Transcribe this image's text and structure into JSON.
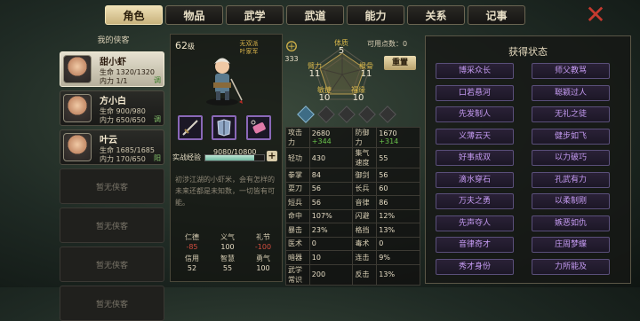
{
  "tabs": [
    "角色",
    "物品",
    "武学",
    "武道",
    "能力",
    "关系",
    "记事"
  ],
  "active_tab": 0,
  "left": {
    "title": "我的侠客",
    "heroes": [
      {
        "name": "甜小虾",
        "hp_label": "生命",
        "hp": "1320/1320",
        "mp_label": "内力",
        "mp": "1/1",
        "tag": "调",
        "selected": true
      },
      {
        "name": "方小白",
        "hp_label": "生命",
        "hp": "900/980",
        "mp_label": "内力",
        "mp": "650/650",
        "tag": "调",
        "selected": false
      },
      {
        "name": "叶云",
        "hp_label": "生命",
        "hp": "1685/1685",
        "mp_label": "内力",
        "mp": "170/650",
        "tag": "阳",
        "selected": false
      }
    ],
    "empty_label": "暂无侠客",
    "empty_count": 4
  },
  "char": {
    "level_num": "62",
    "level_unit": "级",
    "sect_line1": "无双派",
    "sect_line2": "叶家军",
    "exp_label": "实战经验",
    "exp_value": "9080/10800",
    "exp_ratio": 0.84,
    "plus": "+",
    "desc": "初涉江湖的小虾米，会有怎样的未来还都是未知数，一切皆有可能。",
    "virtues": [
      {
        "k": "仁德",
        "v": "-85",
        "neg": true
      },
      {
        "k": "义气",
        "v": "100"
      },
      {
        "k": "礼节",
        "v": "-100",
        "neg": true
      },
      {
        "k": "信用",
        "v": "52"
      },
      {
        "k": "智慧",
        "v": "55"
      },
      {
        "k": "勇气",
        "v": "100"
      }
    ]
  },
  "attrs": {
    "mark_value": "333",
    "free_points_label": "可用点数：",
    "free_points": "0",
    "reset_label": "重置",
    "tizhi": {
      "k": "体质",
      "v": "5"
    },
    "biili": {
      "k": "臂力",
      "v": "11"
    },
    "gengu": {
      "k": "根骨",
      "v": "11"
    },
    "minjie": {
      "k": "敏捷",
      "v": "10"
    },
    "fuyuan": {
      "k": "福缘",
      "v": "10"
    }
  },
  "stats": [
    [
      {
        "k": "攻击力",
        "v": "2680",
        "bonus": "+344"
      },
      {
        "k": "防御力",
        "v": "1670",
        "bonus": "+314"
      }
    ],
    [
      {
        "k": "轻功",
        "v": "430"
      },
      {
        "k": "集气速度",
        "v": "55"
      }
    ],
    [
      {
        "k": "拳掌",
        "v": "84"
      },
      {
        "k": "御剑",
        "v": "56"
      }
    ],
    [
      {
        "k": "耍刀",
        "v": "56"
      },
      {
        "k": "长兵",
        "v": "60"
      }
    ],
    [
      {
        "k": "短兵",
        "v": "56"
      },
      {
        "k": "音律",
        "v": "86"
      }
    ],
    [
      {
        "k": "命中",
        "v": "107%"
      },
      {
        "k": "闪避",
        "v": "12%"
      }
    ],
    [
      {
        "k": "暴击",
        "v": "23%"
      },
      {
        "k": "格挡",
        "v": "13%"
      }
    ],
    [
      {
        "k": "医术",
        "v": "0"
      },
      {
        "k": "毒术",
        "v": "0"
      }
    ],
    [
      {
        "k": "暗器",
        "v": "10"
      },
      {
        "k": "连击",
        "v": "9%"
      }
    ],
    [
      {
        "k": "武学常识",
        "v": "200"
      },
      {
        "k": "反击",
        "v": "13%"
      }
    ]
  ],
  "right": {
    "title": "获得状态",
    "skills": [
      "博采众长",
      "师父教骂",
      "口若悬河",
      "聪颖过人",
      "先发制人",
      "无礼之徒",
      "义薄云天",
      "健步如飞",
      "好事成双",
      "以力破巧",
      "滴水穿石",
      "孔武有力",
      "万夫之勇",
      "以柔制刚",
      "先声夺人",
      "嫉恶如仇",
      "音律奇才",
      "庄周梦蝶",
      "秀才身份",
      "力所能及"
    ]
  },
  "colors": {
    "accent": "#c59bf2",
    "bonus_green": "#69c24b",
    "gold": "#d7b64a",
    "negative": "#d24d3f"
  }
}
